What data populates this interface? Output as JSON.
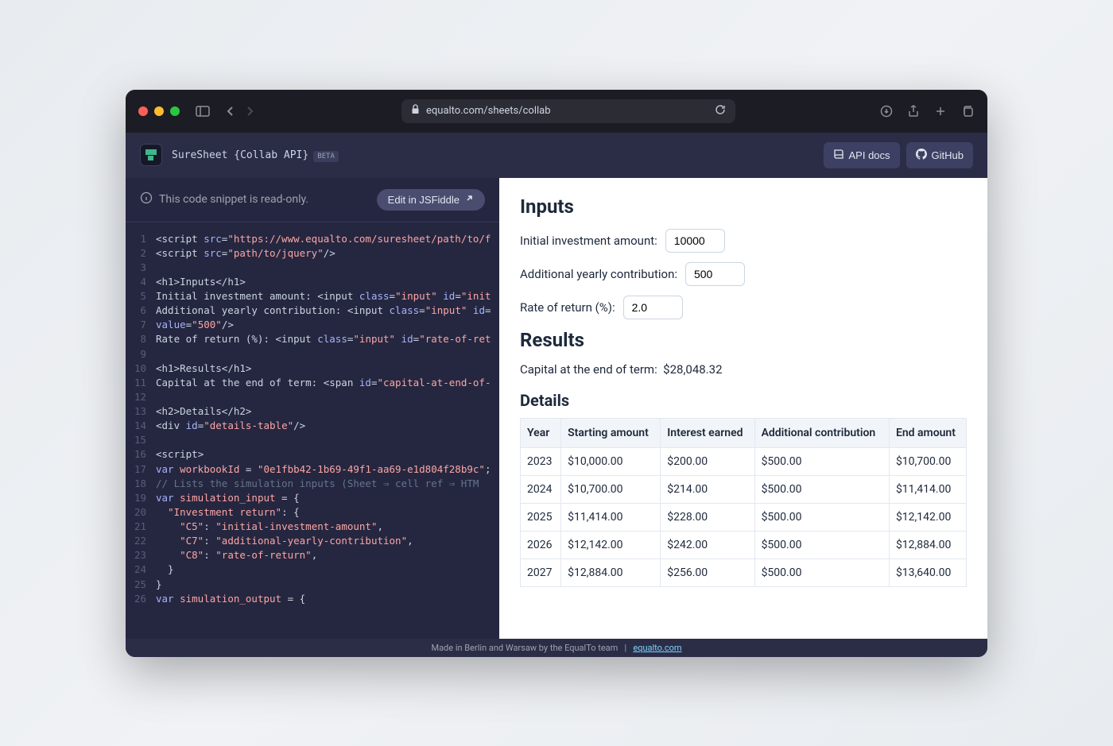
{
  "browser": {
    "url": "equalto.com/sheets/collab"
  },
  "header": {
    "title": "SureSheet {Collab API}",
    "beta": "BETA",
    "api_docs": "API docs",
    "github": "GitHub"
  },
  "code_panel": {
    "readonly": "This code snippet is read-only.",
    "edit_button": "Edit in JSFiddle",
    "lines": [
      {
        "n": "1",
        "html": "&lt;<span class=\"tok-tag\">script</span> <span class=\"tok-attr\">src</span>=<span class=\"tok-str\">\"https://www.equalto.com/suresheet/path/to/f</span>"
      },
      {
        "n": "2",
        "html": "&lt;<span class=\"tok-tag\">script</span> <span class=\"tok-attr\">src</span>=<span class=\"tok-str\">\"path/to/jquery\"</span>/&gt;"
      },
      {
        "n": "3",
        "html": ""
      },
      {
        "n": "4",
        "html": "&lt;<span class=\"tok-tag\">h1</span>&gt;Inputs&lt;/<span class=\"tok-tag\">h1</span>&gt;"
      },
      {
        "n": "5",
        "html": "Initial investment amount: &lt;<span class=\"tok-tag\">input</span> <span class=\"tok-attr\">class</span>=<span class=\"tok-str\">\"input\"</span> <span class=\"tok-attr\">id</span>=<span class=\"tok-str\">\"init</span>"
      },
      {
        "n": "6",
        "html": "Additional yearly contribution: &lt;<span class=\"tok-tag\">input</span> <span class=\"tok-attr\">class</span>=<span class=\"tok-str\">\"input\"</span> <span class=\"tok-attr\">id</span>="
      },
      {
        "n": "7",
        "html": "<span class=\"tok-attr\">value</span>=<span class=\"tok-str\">\"500\"</span>/&gt;"
      },
      {
        "n": "8",
        "html": "Rate of return (%): &lt;<span class=\"tok-tag\">input</span> <span class=\"tok-attr\">class</span>=<span class=\"tok-str\">\"input\"</span> <span class=\"tok-attr\">id</span>=<span class=\"tok-str\">\"rate-of-ret</span>"
      },
      {
        "n": "9",
        "html": ""
      },
      {
        "n": "10",
        "html": "&lt;<span class=\"tok-tag\">h1</span>&gt;Results&lt;/<span class=\"tok-tag\">h1</span>&gt;"
      },
      {
        "n": "11",
        "html": "Capital at the end of term: &lt;<span class=\"tok-tag\">span</span> <span class=\"tok-attr\">id</span>=<span class=\"tok-str\">\"capital-at-end-of-</span>"
      },
      {
        "n": "12",
        "html": ""
      },
      {
        "n": "13",
        "html": "&lt;<span class=\"tok-tag\">h2</span>&gt;Details&lt;/<span class=\"tok-tag\">h2</span>&gt;"
      },
      {
        "n": "14",
        "html": "&lt;<span class=\"tok-tag\">div</span> <span class=\"tok-attr\">id</span>=<span class=\"tok-str\">\"details-table\"</span>/&gt;"
      },
      {
        "n": "15",
        "html": ""
      },
      {
        "n": "16",
        "html": "&lt;<span class=\"tok-tag\">script</span>&gt;"
      },
      {
        "n": "17",
        "html": "<span class=\"tok-kw\">var</span> <span class=\"tok-var\">workbookId</span> = <span class=\"tok-str\">\"0e1fbb42-1b69-49f1-aa69-e1d804f28b9c\"</span>;"
      },
      {
        "n": "18",
        "html": "<span class=\"tok-comment\">// Lists the simulation inputs (Sheet ⇒ cell ref ⇒ HTM</span>"
      },
      {
        "n": "19",
        "html": "<span class=\"tok-kw\">var</span> <span class=\"tok-var\">simulation_input</span> = {"
      },
      {
        "n": "20",
        "html": "  <span class=\"tok-str\">\"Investment return\"</span>: {"
      },
      {
        "n": "21",
        "html": "    <span class=\"tok-str\">\"C5\"</span>: <span class=\"tok-str\">\"initial-investment-amount\"</span>,"
      },
      {
        "n": "22",
        "html": "    <span class=\"tok-str\">\"C7\"</span>: <span class=\"tok-str\">\"additional-yearly-contribution\"</span>,"
      },
      {
        "n": "23",
        "html": "    <span class=\"tok-str\">\"C8\"</span>: <span class=\"tok-str\">\"rate-of-return\"</span>,"
      },
      {
        "n": "24",
        "html": "  }"
      },
      {
        "n": "25",
        "html": "}"
      },
      {
        "n": "26",
        "html": "<span class=\"tok-kw\">var</span> <span class=\"tok-var\">simulation_output</span> = {"
      }
    ]
  },
  "preview": {
    "inputs_heading": "Inputs",
    "initial_label": "Initial investment amount:",
    "initial_value": "10000",
    "additional_label": "Additional yearly contribution:",
    "additional_value": "500",
    "rate_label": "Rate of return (%):",
    "rate_value": "2.0",
    "results_heading": "Results",
    "capital_label": "Capital at the end of term:",
    "capital_value": "$28,048.32",
    "details_heading": "Details",
    "table": {
      "headers": [
        "Year",
        "Starting amount",
        "Interest earned",
        "Additional contribution",
        "End amount"
      ],
      "rows": [
        [
          "2023",
          "$10,000.00",
          "$200.00",
          "$500.00",
          "$10,700.00"
        ],
        [
          "2024",
          "$10,700.00",
          "$214.00",
          "$500.00",
          "$11,414.00"
        ],
        [
          "2025",
          "$11,414.00",
          "$228.00",
          "$500.00",
          "$12,142.00"
        ],
        [
          "2026",
          "$12,142.00",
          "$242.00",
          "$500.00",
          "$12,884.00"
        ],
        [
          "2027",
          "$12,884.00",
          "$256.00",
          "$500.00",
          "$13,640.00"
        ]
      ]
    }
  },
  "footer": {
    "text": "Made in Berlin and Warsaw by the EqualTo team",
    "sep": "|",
    "link": "equalto.com"
  }
}
